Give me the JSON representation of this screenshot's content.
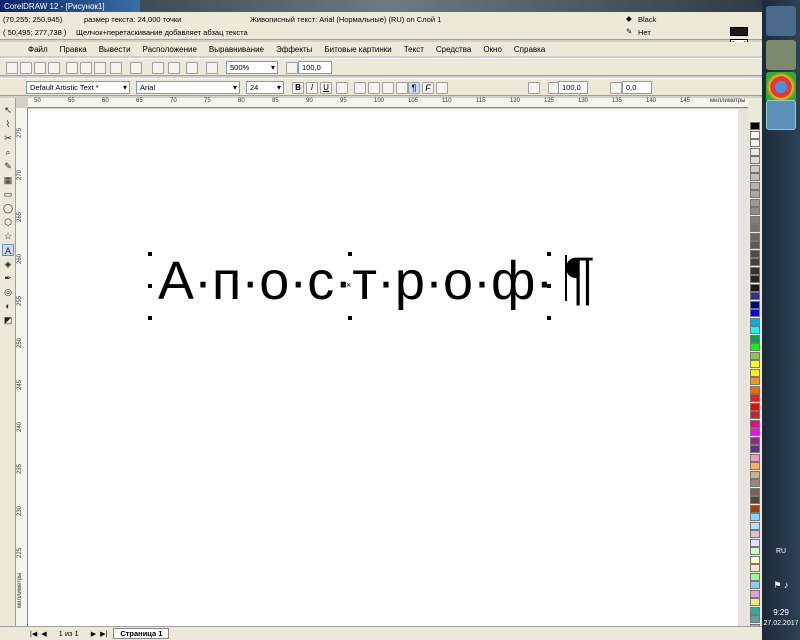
{
  "app": {
    "title": "CorelDRAW 12 - [Рисунок1]",
    "coords1": "(70,255; 250,945)",
    "text_size": "размер текста: 24,000 точки",
    "coords2": "( 50,495; 277,738 )",
    "hint": "Щелчок+перетаскивание добавляет абзац текста",
    "object_info": "Живописный текст: Arial (Нормальные) (RU) on Слой 1",
    "fill_name": "Black",
    "outline_name": "Нет",
    "colors": {
      "fill": "#1a1a1a",
      "title_bg": "#3a6ea5",
      "accent": "#0a246a"
    }
  },
  "menu": [
    "Файл",
    "Правка",
    "Вывести",
    "Расположение",
    "Выравнивание",
    "Эффекты",
    "Битовые картинки",
    "Текст",
    "Средства",
    "Окно",
    "Справка"
  ],
  "toolbar": {
    "zoom": "500%",
    "nudge": "100,0"
  },
  "propbar": {
    "style": "Default Artistic Text *",
    "font": "Arial",
    "size": "24",
    "width": "100,0",
    "angle": "0,0"
  },
  "ruler": {
    "h_labels": [
      "50",
      "55",
      "60",
      "65",
      "70",
      "75",
      "80",
      "85",
      "90",
      "95",
      "100",
      "105",
      "110",
      "115",
      "120",
      "125",
      "130",
      "135",
      "140",
      "145"
    ],
    "h_unit": "миллиметры",
    "v_labels": [
      "275",
      "270",
      "265",
      "260",
      "255",
      "250",
      "245",
      "240",
      "235",
      "230",
      "225"
    ],
    "v_unit": "миллиметры"
  },
  "canvas": {
    "word": "А·п·о·с·т·р·о·ф·",
    "pilcrow": "¶"
  },
  "pages": {
    "counter": "1 из 1",
    "tab": "Страница 1"
  },
  "taskbar": {
    "lang": "RU",
    "time": "9:29",
    "date": "27.02.2017"
  },
  "palette": [
    "#000000",
    "#ffffff",
    "#f2f2f2",
    "#e6e6e6",
    "#d9d9d9",
    "#cccccc",
    "#bfbfbf",
    "#b3b3b3",
    "#a6a6a6",
    "#999999",
    "#8c8c8c",
    "#808080",
    "#737373",
    "#666666",
    "#595959",
    "#4d4d4d",
    "#404040",
    "#333333",
    "#262626",
    "#1a1a1a",
    "#2e3192",
    "#00008b",
    "#0000ff",
    "#00aeef",
    "#00ffff",
    "#00a651",
    "#00ff00",
    "#8dc63f",
    "#ffff00",
    "#fff200",
    "#f7941d",
    "#ff6600",
    "#ed1c24",
    "#ff0000",
    "#c1272d",
    "#ec008c",
    "#ff00ff",
    "#92278f",
    "#662d91",
    "#f49ac1",
    "#fbaf5d",
    "#c7b299",
    "#998675",
    "#736357",
    "#534741",
    "#a0410d",
    "#7fdbff",
    "#b4e1fa",
    "#d8bfd8",
    "#e0e0ff",
    "#ccffcc",
    "#ffffcc",
    "#ffe4c4",
    "#98fb98",
    "#87cefa",
    "#dda0dd",
    "#f0e68c",
    "#20b2aa",
    "#5f9ea0",
    "#66cdaa"
  ]
}
